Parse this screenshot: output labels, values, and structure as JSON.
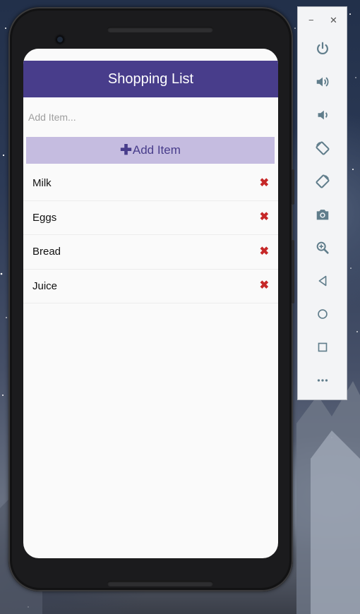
{
  "app": {
    "title": "Shopping List",
    "input_placeholder": "Add Item...",
    "add_button_label": "Add Item",
    "items": [
      {
        "name": "Milk"
      },
      {
        "name": "Eggs"
      },
      {
        "name": "Bread"
      },
      {
        "name": "Juice"
      }
    ]
  },
  "colors": {
    "header": "#483d8b",
    "add_button_bg": "#c5bce0",
    "delete": "#c62828"
  },
  "emulator": {
    "window_buttons": [
      "minimize-icon",
      "close-icon"
    ],
    "tools": [
      "power-icon",
      "volume-up-icon",
      "volume-down-icon",
      "rotate-left-icon",
      "rotate-right-icon",
      "camera-icon",
      "zoom-icon",
      "back-icon",
      "home-icon",
      "overview-icon",
      "more-icon"
    ]
  }
}
